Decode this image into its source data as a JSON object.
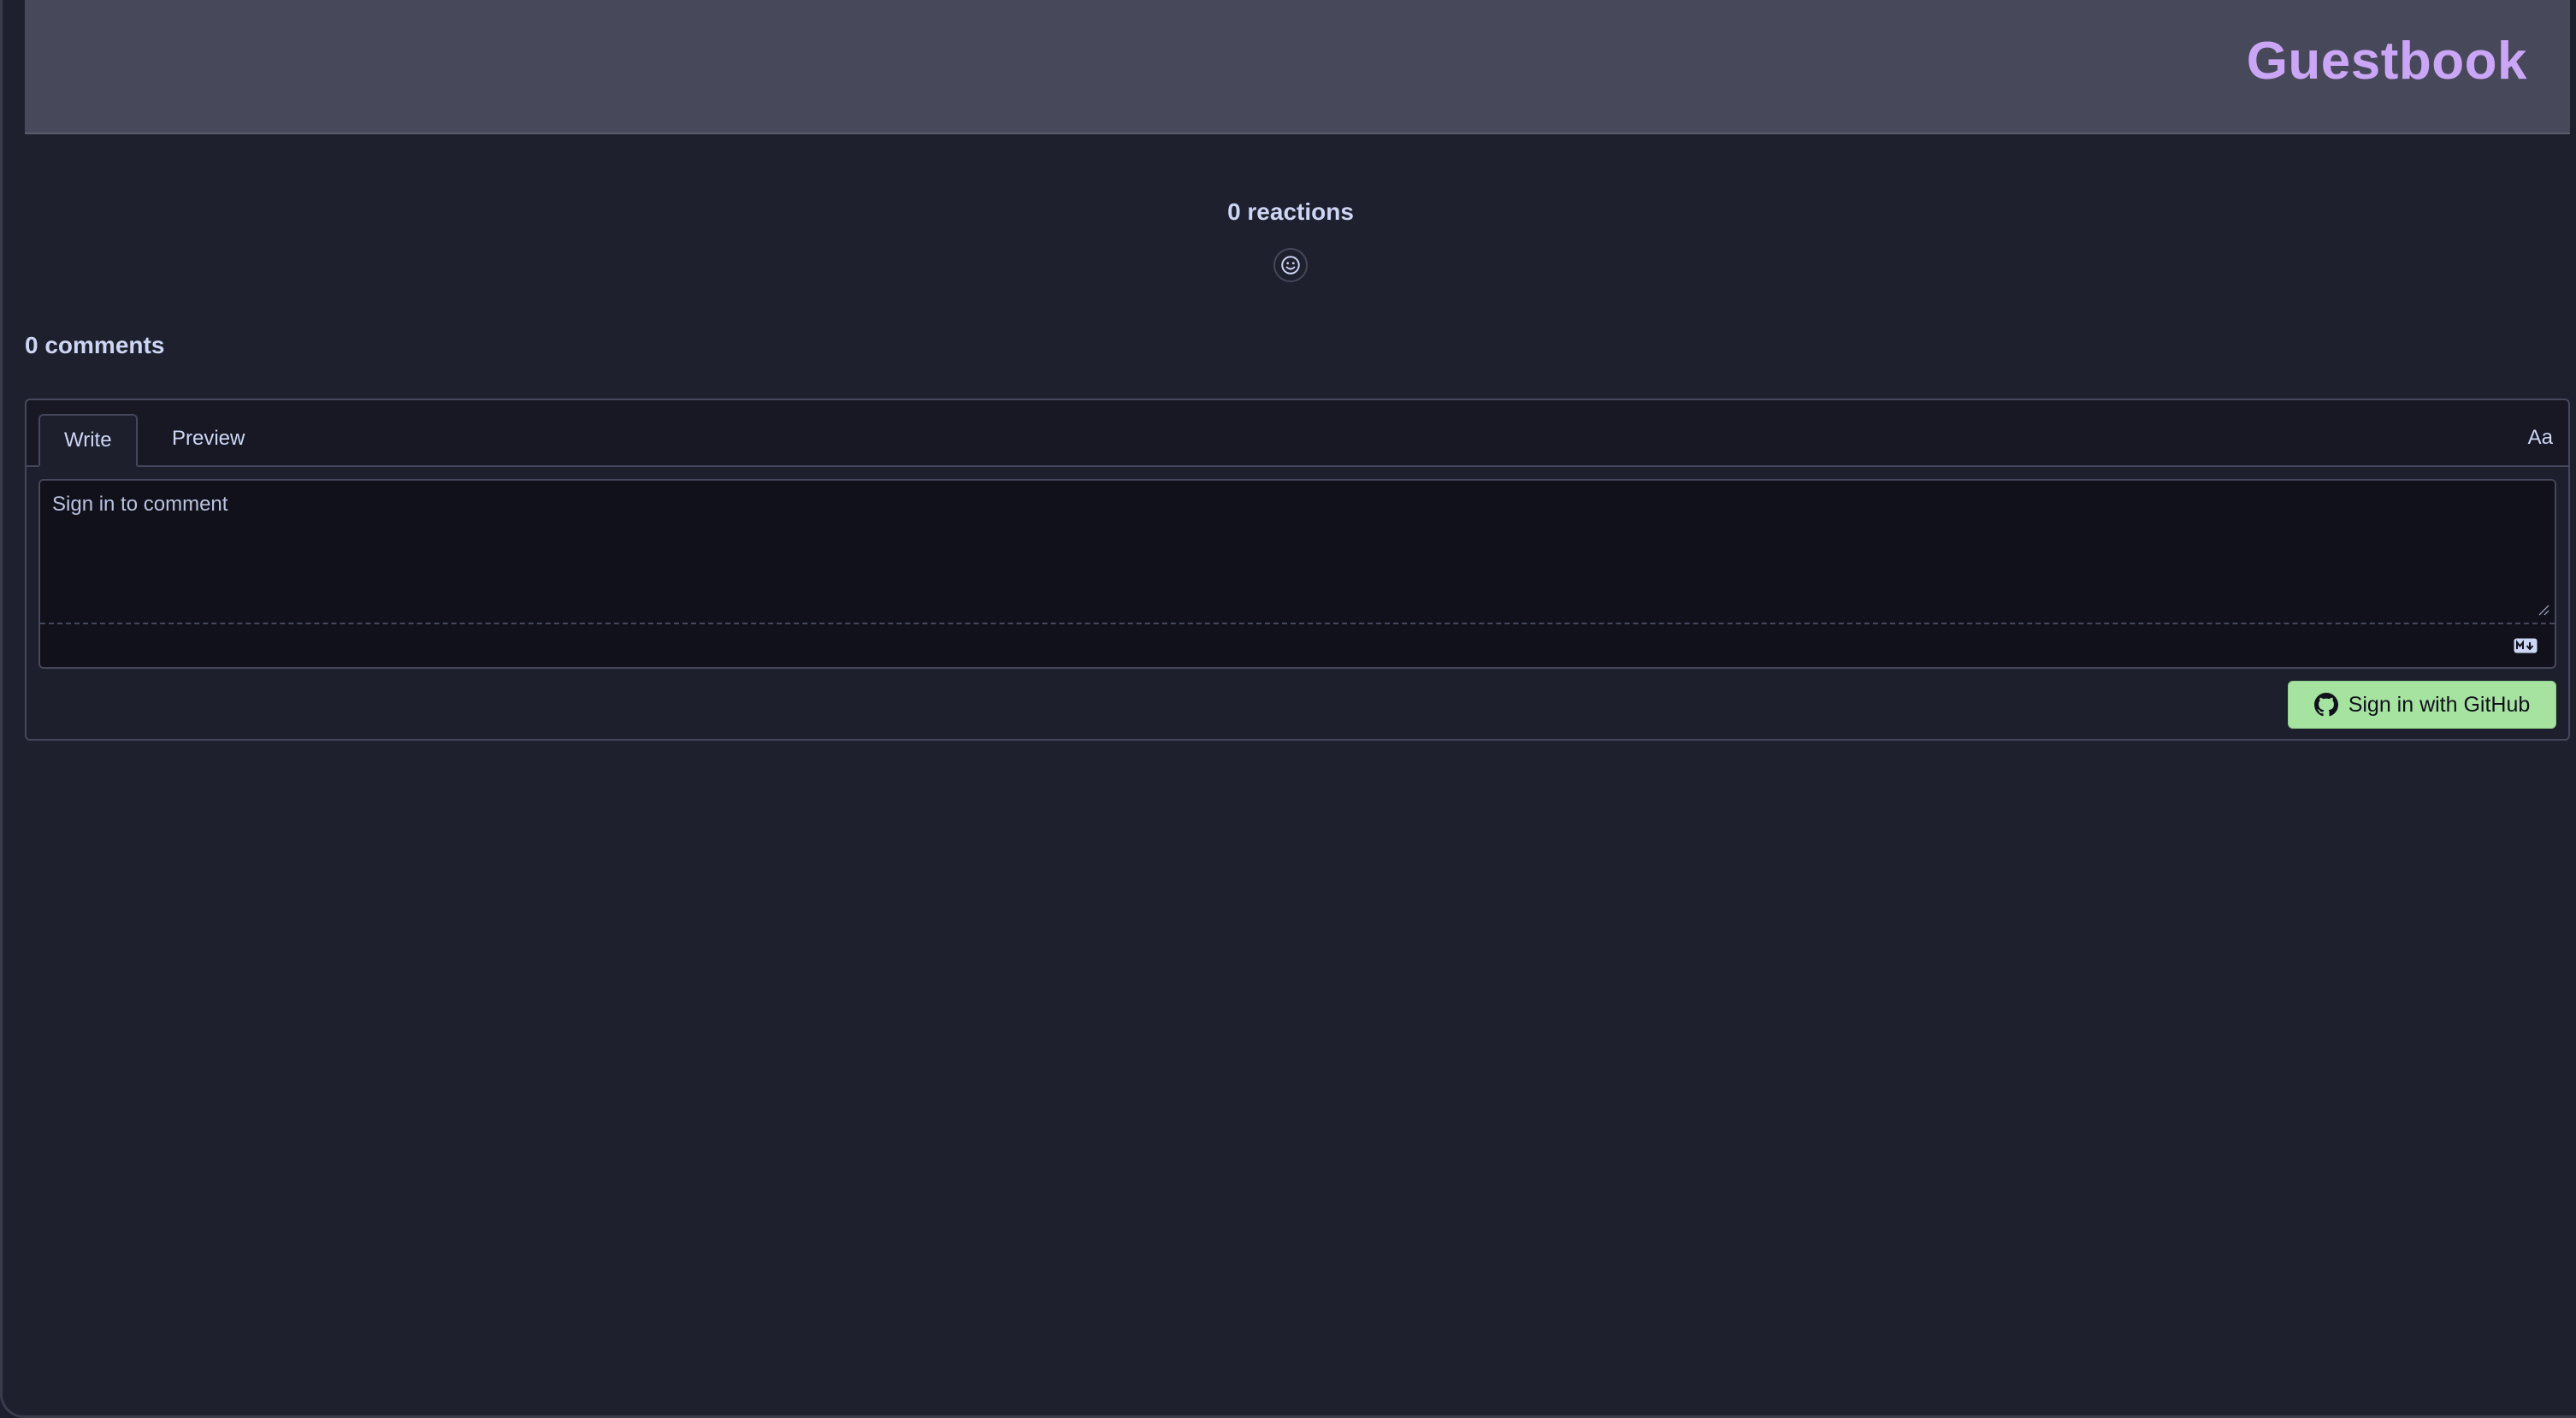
{
  "header": {
    "title": "Guestbook"
  },
  "reactions": {
    "count_label": "0 reactions",
    "add_icon": "smiley-icon"
  },
  "comments": {
    "count_label": "0 comments"
  },
  "editor": {
    "tabs": [
      {
        "label": "Write",
        "active": true
      },
      {
        "label": "Preview",
        "active": false
      }
    ],
    "font_toggle_label": "Aa",
    "placeholder": "Sign in to comment",
    "markdown_icon": "markdown-icon"
  },
  "signin": {
    "label": "Sign in with GitHub",
    "icon": "github-icon"
  },
  "colors": {
    "accent": "#cba6f7",
    "button_bg": "#a6e3a1",
    "background": "#1e1f2d",
    "header_bg": "#474859"
  }
}
